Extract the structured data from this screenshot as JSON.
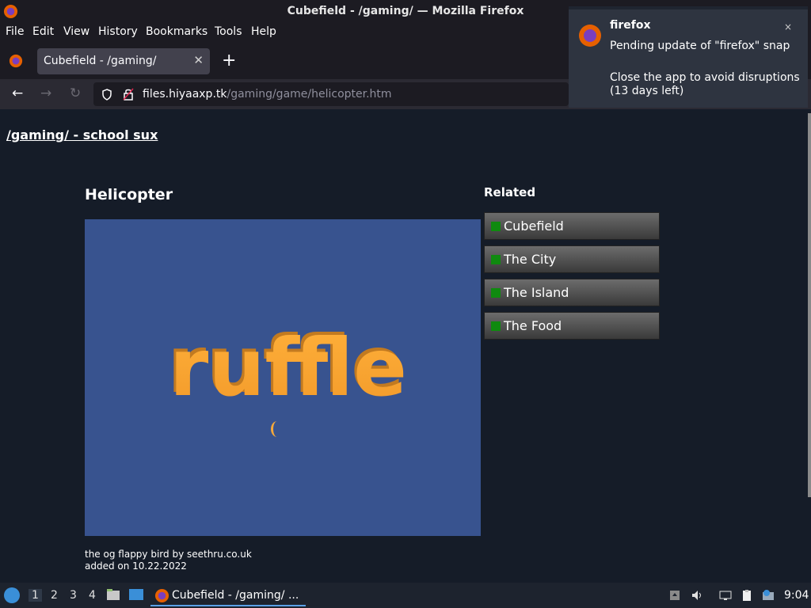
{
  "window": {
    "title": "Cubefield - /gaming/ — Mozilla Firefox"
  },
  "menubar": {
    "items": [
      "File",
      "Edit",
      "View",
      "History",
      "Bookmarks",
      "Tools",
      "Help"
    ]
  },
  "tabs": [
    {
      "label": "Cubefield - /gaming/",
      "active": true
    }
  ],
  "toolbar": {
    "url_host": "files.hiyaaxp.tk",
    "url_path": "/gaming/game/helicopter.htm",
    "url_prefix": ""
  },
  "page": {
    "site_title": "/gaming/ - school sux",
    "game_title": "Helicopter",
    "game_description": "the og flappy bird by seethru.co.uk",
    "game_added": "added on 10.22.2022",
    "player_logo_text": "ruffle",
    "related": {
      "title": "Related",
      "items": [
        "Cubefield",
        "The City",
        "The Island",
        "The Food"
      ]
    }
  },
  "notification": {
    "app": "firefox",
    "body1": "Pending update of \"firefox\" snap",
    "body2": "Close the app to avoid disruptions (13 days left)",
    "close": "×"
  },
  "taskbar": {
    "workspaces": [
      "1",
      "2",
      "3",
      "4"
    ],
    "active_workspace": "1",
    "app_label": "Cubefield - /gaming/ ...",
    "clock": "9:04"
  },
  "colors": {
    "accent": "#f6a93a",
    "game_bg": "#38538f",
    "page_bg": "#151c28"
  }
}
